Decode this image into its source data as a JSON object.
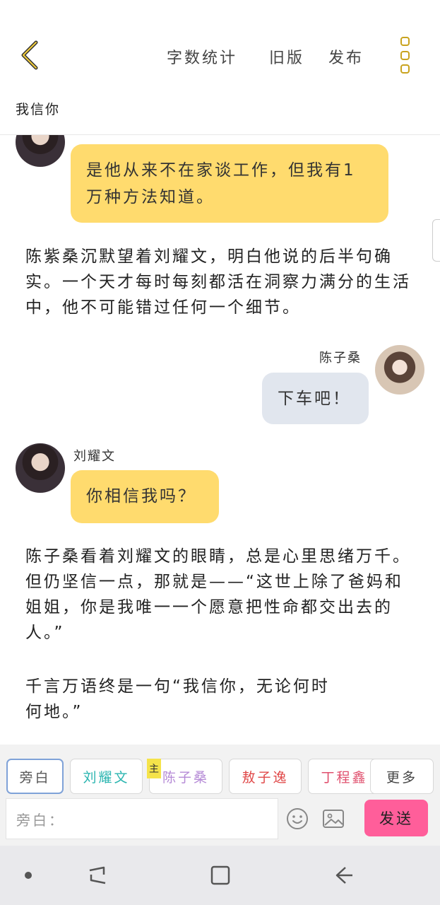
{
  "header": {
    "word_count_label": "字数统计",
    "old_version_label": "旧版",
    "publish_label": "发布"
  },
  "story_title": "我信你",
  "messages": [
    {
      "type": "bubble",
      "text": "是他从来不在家谈工作，但我有1万种方法知道。"
    },
    {
      "type": "narration",
      "text": "陈紫桑沉默望着刘耀文，明白他说的后半句确实。一个天才每时每刻都活在洞察力满分的生活中，他不可能错过任何一个细节。"
    },
    {
      "type": "bubble",
      "speaker": "陈子桑",
      "text": "下车吧！"
    },
    {
      "type": "bubble",
      "speaker": "刘耀文",
      "text": "你相信我吗？"
    },
    {
      "type": "narration",
      "text": "陈子桑看着刘耀文的眼睛，总是心里思绪万千。但仍坚信一点，那就是——“这世上除了爸妈和姐姐，你是我唯一一个愿意把性命都交出去的人。”"
    },
    {
      "type": "narration",
      "text": "千言万语终是一句“我信你，无论何时何地。”"
    }
  ],
  "roles": [
    {
      "label": "旁白",
      "color": "#555555"
    },
    {
      "label": "刘耀文",
      "color": "#2bb5b0"
    },
    {
      "label": "陈子桑",
      "color": "#b58ad6",
      "tag": "主"
    },
    {
      "label": "敖子逸",
      "color": "#e04848"
    },
    {
      "label": "丁程鑫",
      "color": "#e0506e"
    },
    {
      "label": "更多",
      "color": "#444444"
    }
  ],
  "composer": {
    "placeholder": "旁白：",
    "send_label": "发送"
  },
  "colors": {
    "accent_yellow": "#ffdb6e",
    "send_pink": "#ff5e9a",
    "right_bubble": "#e1e6ee"
  },
  "icons": [
    "back-arrow-icon",
    "more-dots-icon",
    "emoji-icon",
    "image-icon",
    "home-dot-icon",
    "recents-icon",
    "overview-icon",
    "nav-back-icon"
  ]
}
